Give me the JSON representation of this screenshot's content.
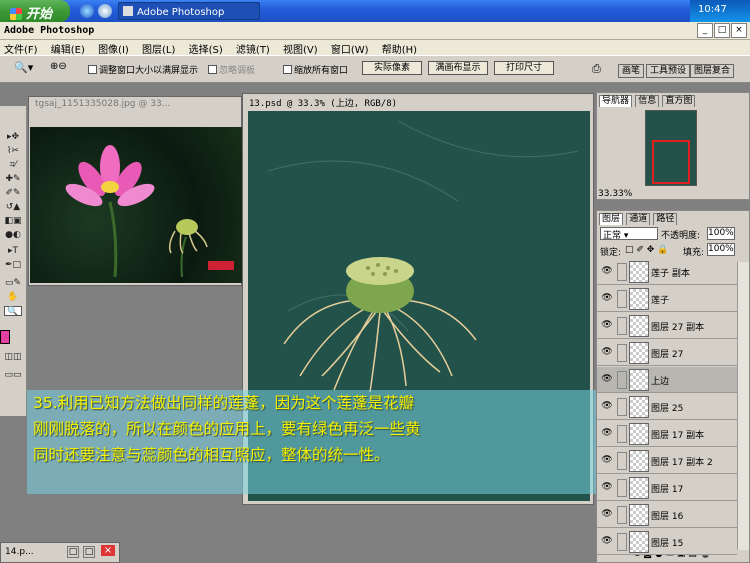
{
  "taskbar": {
    "start_label": "开始",
    "window_button": "Adobe Photoshop",
    "clock": "10:47"
  },
  "app": {
    "title": "Adobe Photoshop"
  },
  "menu": [
    "文件(F)",
    "编辑(E)",
    "图像(I)",
    "图层(L)",
    "选择(S)",
    "滤镜(T)",
    "视图(V)",
    "窗口(W)",
    "帮助(H)"
  ],
  "options": {
    "check1": "调整窗口大小以满屏显示",
    "check2": "忽略调板",
    "check3": "缩放所有窗口",
    "btn_actual": "实际像素",
    "btn_fit": "满画布显示",
    "btn_print": "打印尺寸"
  },
  "palette_tabs": [
    "画笔",
    "工具预设",
    "图层复合"
  ],
  "doc1": {
    "title": "tgsaj_1151335028.jpg @ 33..."
  },
  "doc2": {
    "title": "13.psd @ 33.3% (上边, RGB/8)"
  },
  "navigator": {
    "tabs": [
      "导航器",
      "信息",
      "直方图"
    ],
    "zoom": "33.33%"
  },
  "layers": {
    "tabs": [
      "图层",
      "通道",
      "路径"
    ],
    "blend": "正常",
    "opacity_label": "不透明度:",
    "opacity": "100%",
    "lock_label": "锁定:",
    "fill_label": "填充:",
    "fill": "100%",
    "items": [
      "莲子 副本",
      "莲子",
      "图层 27 副本",
      "图层 27",
      "上边",
      "图层 25",
      "图层 17 副本",
      "图层 17 副本 2",
      "图层 17",
      "图层 16",
      "图层 15"
    ]
  },
  "caption": {
    "line1": "35.利用已知方法做出同样的莲蓬，因为这个莲蓬是花瓣",
    "line2": "刚刚脱落的，所以在颜色的应用上，要有绿色再泛一些黄",
    "line3": "同时还要注意与蕊颜色的相互照应，整体的统一性。"
  },
  "bottom_doc": {
    "title": "14.p..."
  },
  "colors": {
    "foreground": "#e040a0",
    "canvas": "#23524a",
    "caption_text": "#f6f100"
  }
}
